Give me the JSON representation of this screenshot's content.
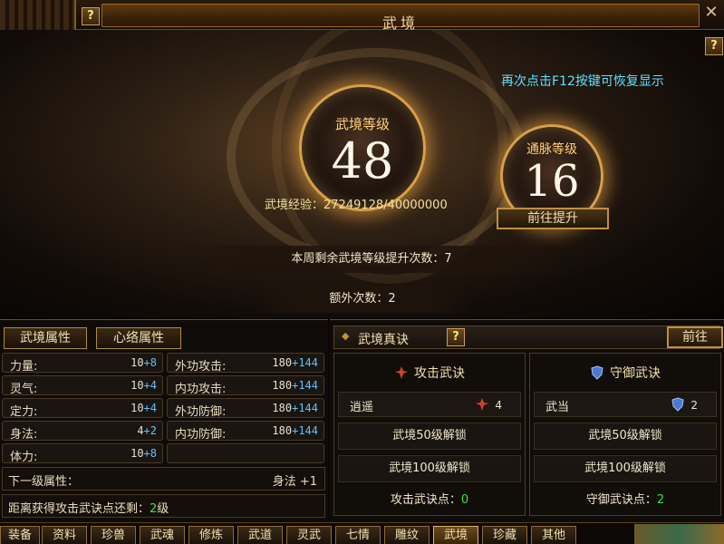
{
  "window": {
    "title": "武境",
    "help": "?",
    "close": "✕"
  },
  "hint": "再次点击F12按键可恢复显示",
  "level": {
    "label": "武境等级",
    "value": "48"
  },
  "meridian": {
    "label": "通脉等级",
    "value": "16"
  },
  "experience": "武境经验：27249128/40000000",
  "goto_upgrade": "前往提升",
  "weekly_remaining": "本周剩余武境等级提升次数：7",
  "extra_count": "额外次数：2",
  "left_tabs": [
    "武境属性",
    "心络属性"
  ],
  "stats_left": [
    {
      "k": "力量:",
      "base": "10",
      "add": "+8"
    },
    {
      "k": "灵气:",
      "base": "10",
      "add": "+4"
    },
    {
      "k": "定力:",
      "base": "10",
      "add": "+4"
    },
    {
      "k": "身法:",
      "base": "4",
      "add": "+2"
    },
    {
      "k": "体力:",
      "base": "10",
      "add": "+8"
    }
  ],
  "stats_right": [
    {
      "k": "外功攻击:",
      "base": "180",
      "add": "+144"
    },
    {
      "k": "内功攻击:",
      "base": "180",
      "add": "+144"
    },
    {
      "k": "外功防御:",
      "base": "180",
      "add": "+144"
    },
    {
      "k": "内功防御:",
      "base": "180",
      "add": "+144"
    }
  ],
  "next_level": {
    "label": "下一级属性：",
    "value": "身法 +1"
  },
  "remain": {
    "prefix": "距离获得攻击武诀点还剩：",
    "num": "2",
    "suffix": "级"
  },
  "right_panel": {
    "title": "武境真诀",
    "help": "?",
    "goto": "前往",
    "attack": {
      "title": "攻击武诀",
      "row_name": "逍遥",
      "row_count": "4",
      "unlock50": "武境50级解锁",
      "unlock100": "武境100级解锁",
      "points_label": "攻击武诀点：",
      "points": "0"
    },
    "defense": {
      "title": "守御武诀",
      "row_name": "武当",
      "row_count": "2",
      "unlock50": "武境50级解锁",
      "unlock100": "武境100级解锁",
      "points_label": "守御武诀点：",
      "points": "2"
    }
  },
  "bottom_tabs": [
    "装备",
    "资料",
    "珍兽",
    "武魂",
    "修炼",
    "武道",
    "灵武",
    "七情",
    "雕纹",
    "武境",
    "珍藏",
    "其他"
  ],
  "active_tab": "武境",
  "colors": {
    "accent": "#c09040",
    "hint": "#5fe0ff",
    "bonus": "#5fc0ff",
    "good": "#40e040"
  }
}
